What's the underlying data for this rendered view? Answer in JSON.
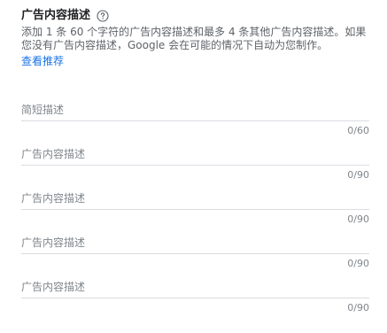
{
  "section": {
    "title": "广告内容描述",
    "help_icon": "help-circle-icon",
    "description": "添加 1 条 60 个字符的广告内容描述和最多 4 条其他广告内容描述。如果您没有广告内容描述，Google 会在可能的情况下自动为您制作。",
    "link_label": "查看推荐"
  },
  "fields": [
    {
      "placeholder": "简短描述",
      "value": "",
      "counter": "0/60"
    },
    {
      "placeholder": "广告内容描述",
      "value": "",
      "counter": "0/90"
    },
    {
      "placeholder": "广告内容描述",
      "value": "",
      "counter": "0/90"
    },
    {
      "placeholder": "广告内容描述",
      "value": "",
      "counter": "0/90"
    },
    {
      "placeholder": "广告内容描述",
      "value": "",
      "counter": "0/90"
    }
  ],
  "colors": {
    "link": "#1a73e8",
    "divider": "#dadce0",
    "muted_text": "#80868b"
  }
}
